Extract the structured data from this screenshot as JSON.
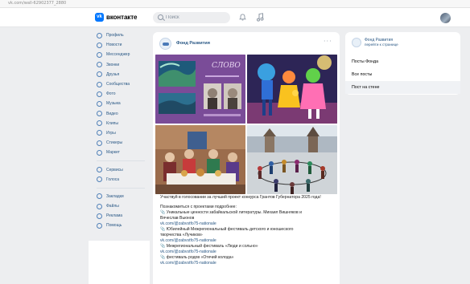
{
  "browser": {
    "url": "vk.com/wall-62902377_2880"
  },
  "header": {
    "logo_text": "вконтакте",
    "search_placeholder": "Поиск"
  },
  "sidebar": {
    "items": [
      {
        "label": "Профиль",
        "icon": "profile-icon"
      },
      {
        "label": "Новости",
        "icon": "news-icon"
      },
      {
        "label": "Мессенджер",
        "icon": "messenger-icon"
      },
      {
        "label": "Звонки",
        "icon": "calls-icon"
      },
      {
        "label": "Друзья",
        "icon": "friends-icon"
      },
      {
        "label": "Сообщества",
        "icon": "communities-icon"
      },
      {
        "label": "Фото",
        "icon": "photos-icon"
      },
      {
        "label": "Музыка",
        "icon": "music-icon"
      },
      {
        "label": "Видео",
        "icon": "video-icon"
      },
      {
        "label": "Клипы",
        "icon": "clips-icon"
      },
      {
        "label": "Игры",
        "icon": "games-icon"
      },
      {
        "label": "Стикеры",
        "icon": "stickers-icon"
      },
      {
        "label": "Маркет",
        "icon": "market-icon"
      }
    ],
    "items2": [
      {
        "label": "Сервисы",
        "icon": "services-icon"
      },
      {
        "label": "Голоса",
        "icon": "votes-icon"
      }
    ],
    "items3": [
      {
        "label": "Закладки",
        "icon": "bookmarks-icon"
      },
      {
        "label": "Файлы",
        "icon": "files-icon"
      },
      {
        "label": "Реклама",
        "icon": "ads-icon"
      },
      {
        "label": "Помощь",
        "icon": "help-icon"
      }
    ]
  },
  "post": {
    "author": "Фонд Развития",
    "intro": "Участвуй в голосовании за лучший проект конкурса Грантов Губернатора 2025 года!",
    "lines": [
      {
        "text": "Познакомиться с проектами подробнее:",
        "link": false
      },
      {
        "text": "📎 Уникальные ценности забайкальской литературы. Михаил Вишняков и",
        "link": false
      },
      {
        "text": "Вячеслав Вьюнов",
        "link": false
      },
      {
        "text": "vk.com/@zabvstfo75-nationale",
        "link": true
      },
      {
        "text": "📎 Юбилейный Межрегиональный фестиваль детского и юношеского",
        "link": false
      },
      {
        "text": "творчества «Лучиков»",
        "link": false
      },
      {
        "text": "vk.com/@zabvstfo75-nationale",
        "link": true
      },
      {
        "text": "📎 Межрегиональный фестиваль «Люди и сольно»",
        "link": false
      },
      {
        "text": "vk.com/@zabvstfo75-nationale",
        "link": true
      },
      {
        "text": "📎 фестиваль родов «Отечий колода»",
        "link": false
      },
      {
        "text": "vk.com/@zabvstfo75-nationale",
        "link": true
      }
    ]
  },
  "right_card": {
    "name": "Фонд Развития",
    "sub": "перейти к странице",
    "items": [
      {
        "label": "Посты Фонда"
      },
      {
        "label": "Все посты"
      },
      {
        "label": "Пост на стене"
      }
    ]
  },
  "colors": {
    "accent": "#0077ff",
    "link": "#2a5885",
    "background": "#edeef0"
  }
}
